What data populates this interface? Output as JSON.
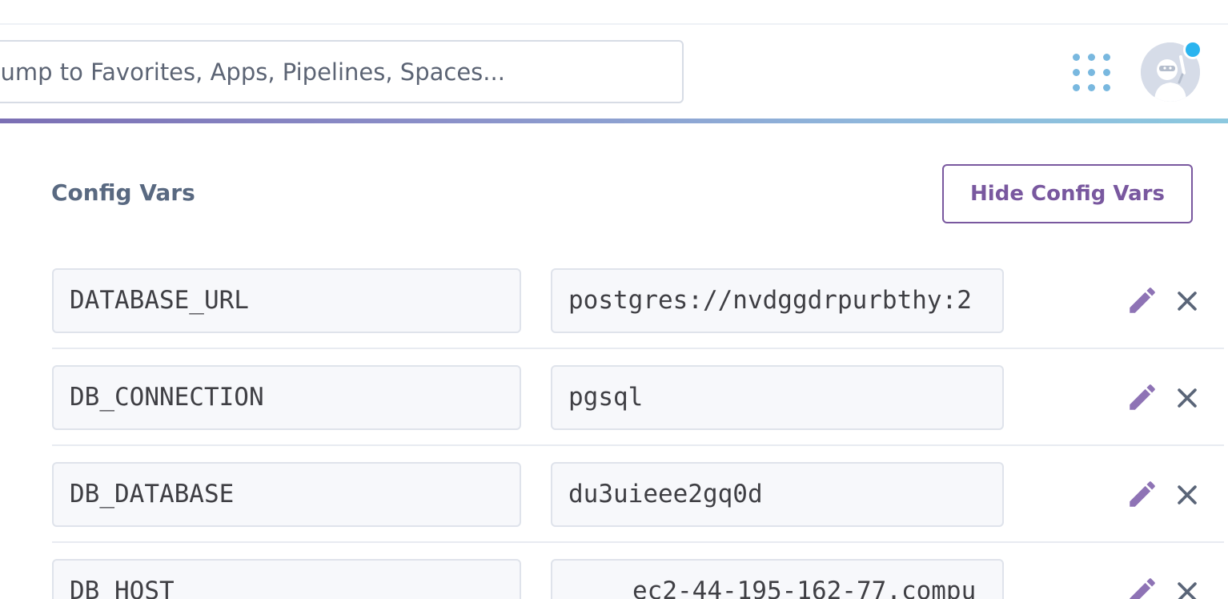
{
  "header": {
    "search": {
      "placeholder": "Jump to Favorites, Apps, Pipelines, Spaces..."
    },
    "apps_menu_icon": "grid-dots-icon",
    "avatar_icon": "ninja-avatar-icon",
    "notification_color": "#2ab4ef"
  },
  "config_vars": {
    "title": "Config Vars",
    "hide_button_label": "Hide Config Vars",
    "accent_color": "#79589f",
    "rows": [
      {
        "key": "DATABASE_URL",
        "value": "postgres://nvdggdrpurbthy:2"
      },
      {
        "key": "DB_CONNECTION",
        "value": "pgsql"
      },
      {
        "key": "DB_DATABASE",
        "value": "du3uieee2gq0d"
      },
      {
        "key": "DB_HOST",
        "value": "ec2-44-195-162-77.compu"
      }
    ]
  }
}
